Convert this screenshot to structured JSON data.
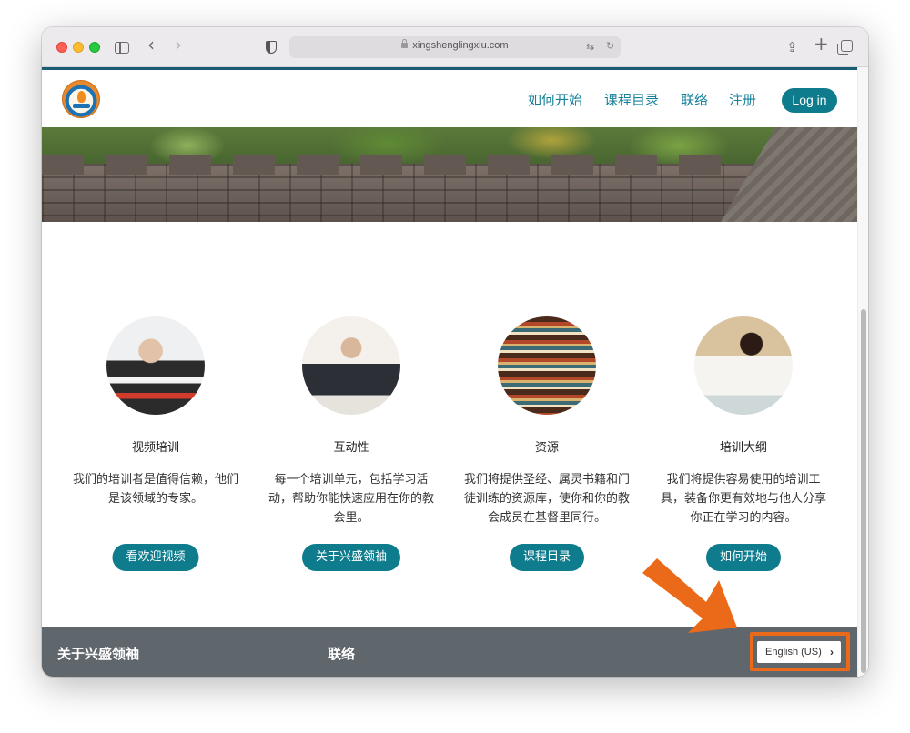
{
  "browser": {
    "url": "xingshenglingxiu.com",
    "icons": [
      "sidebar-icon",
      "back-icon",
      "forward-icon",
      "shield-icon",
      "lock-icon",
      "translate-icon",
      "reload-icon",
      "share-icon",
      "new-tab-icon",
      "tabs-overview-icon"
    ]
  },
  "nav": {
    "links": [
      "如何开始",
      "课程目录",
      "联络",
      "注册"
    ],
    "login_label": "Log in"
  },
  "features": [
    {
      "title": "视频培训",
      "desc": "我们的培训者是值得信赖，他们是该领域的专家。",
      "button": "看欢迎视频"
    },
    {
      "title": "互动性",
      "desc": "每一个培训单元，包括学习活动，帮助你能快速应用在你的教会里。",
      "button": "关于兴盛领袖"
    },
    {
      "title": "资源",
      "desc": "我们将提供圣经、属灵书籍和门徒训练的资源库，使你和你的教会成员在基督里同行。",
      "button": "课程目录"
    },
    {
      "title": "培训大纲",
      "desc": "我们将提供容易使用的培训工具，装备你更有效地与他人分享你正在学习的内容。",
      "button": "如何开始"
    }
  ],
  "footer": {
    "about_label": "关于兴盛领袖",
    "contact_label": "联络",
    "language_label": "English (US)",
    "language_chevron": "›"
  },
  "colors": {
    "accent": "#0f7c8e",
    "nav_link": "#16819a",
    "footer_bg": "#5f666c",
    "annotation": "#ea6a1a"
  }
}
